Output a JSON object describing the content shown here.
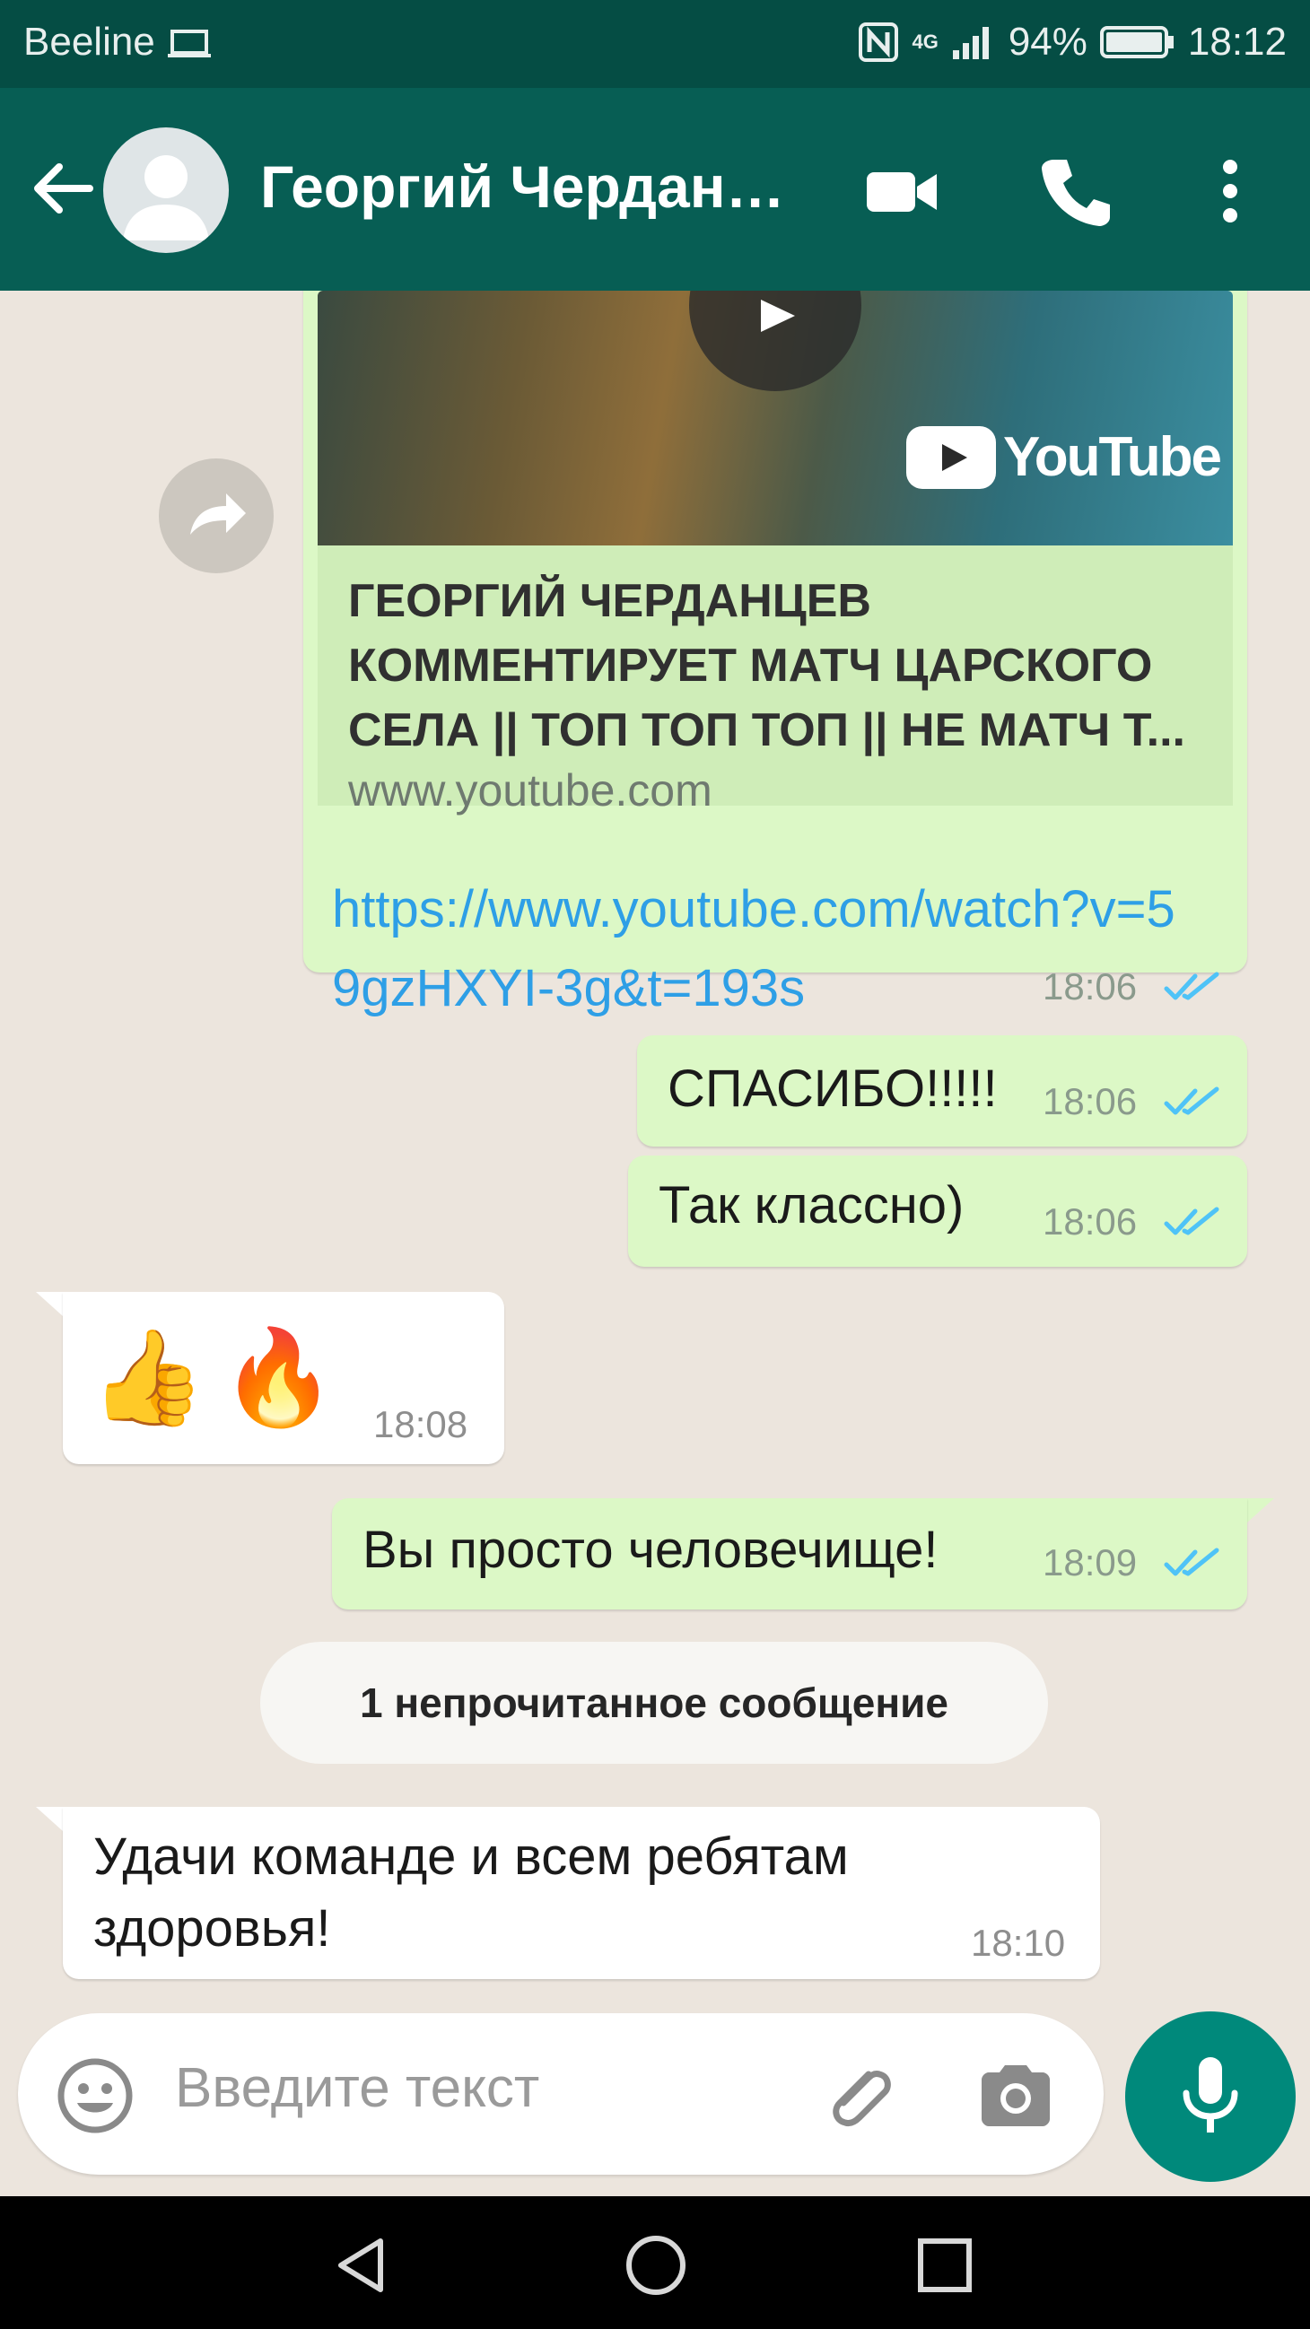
{
  "status": {
    "carrier": "Beeline",
    "network": "4G",
    "battery": "94%",
    "time": "18:12"
  },
  "header": {
    "contact_name": "Георгий Черданцев",
    "icons": [
      "back-arrow-icon",
      "avatar-placeholder-icon",
      "video-call-icon",
      "phone-icon",
      "more-vert-icon"
    ]
  },
  "messages": {
    "link_msg": {
      "preview_brand": "YouTube",
      "preview_title": "ГЕОРГИЙ ЧЕРДАНЦЕВ КОММЕНТИРУЕТ МАТЧ ЦАРСКОГО СЕЛА || ТОП ТОП ТОП || НЕ МАТЧ Т...",
      "preview_site": "www.youtube.com",
      "url": "https://www.youtube.com/watch?v=59gzHXYI-3g&t=193s",
      "time": "18:06"
    },
    "m1": {
      "text": "СПАСИБО!!!!!",
      "time": "18:06"
    },
    "m2": {
      "text": "Так классно)",
      "time": "18:06"
    },
    "m3": {
      "text": "👍🔥",
      "time": "18:08"
    },
    "m4": {
      "text": "Вы просто человечище!",
      "time": "18:09"
    },
    "unread_banner": "1 непрочитанное сообщение",
    "m5": {
      "line1": "Удачи команде и всем ребятам",
      "line2": "здоровья!",
      "time": "18:10"
    }
  },
  "input": {
    "placeholder": "Введите текст",
    "icons": [
      "emoji-icon",
      "attach-icon",
      "camera-icon",
      "mic-icon"
    ]
  },
  "colors": {
    "header": "#075E54",
    "outgoing_bubble": "#DCF8C6",
    "incoming_bubble": "#FFFFFF",
    "read_ticks": "#4FC3F7",
    "link": "#2E9FE6",
    "mic_button": "#00897B"
  }
}
